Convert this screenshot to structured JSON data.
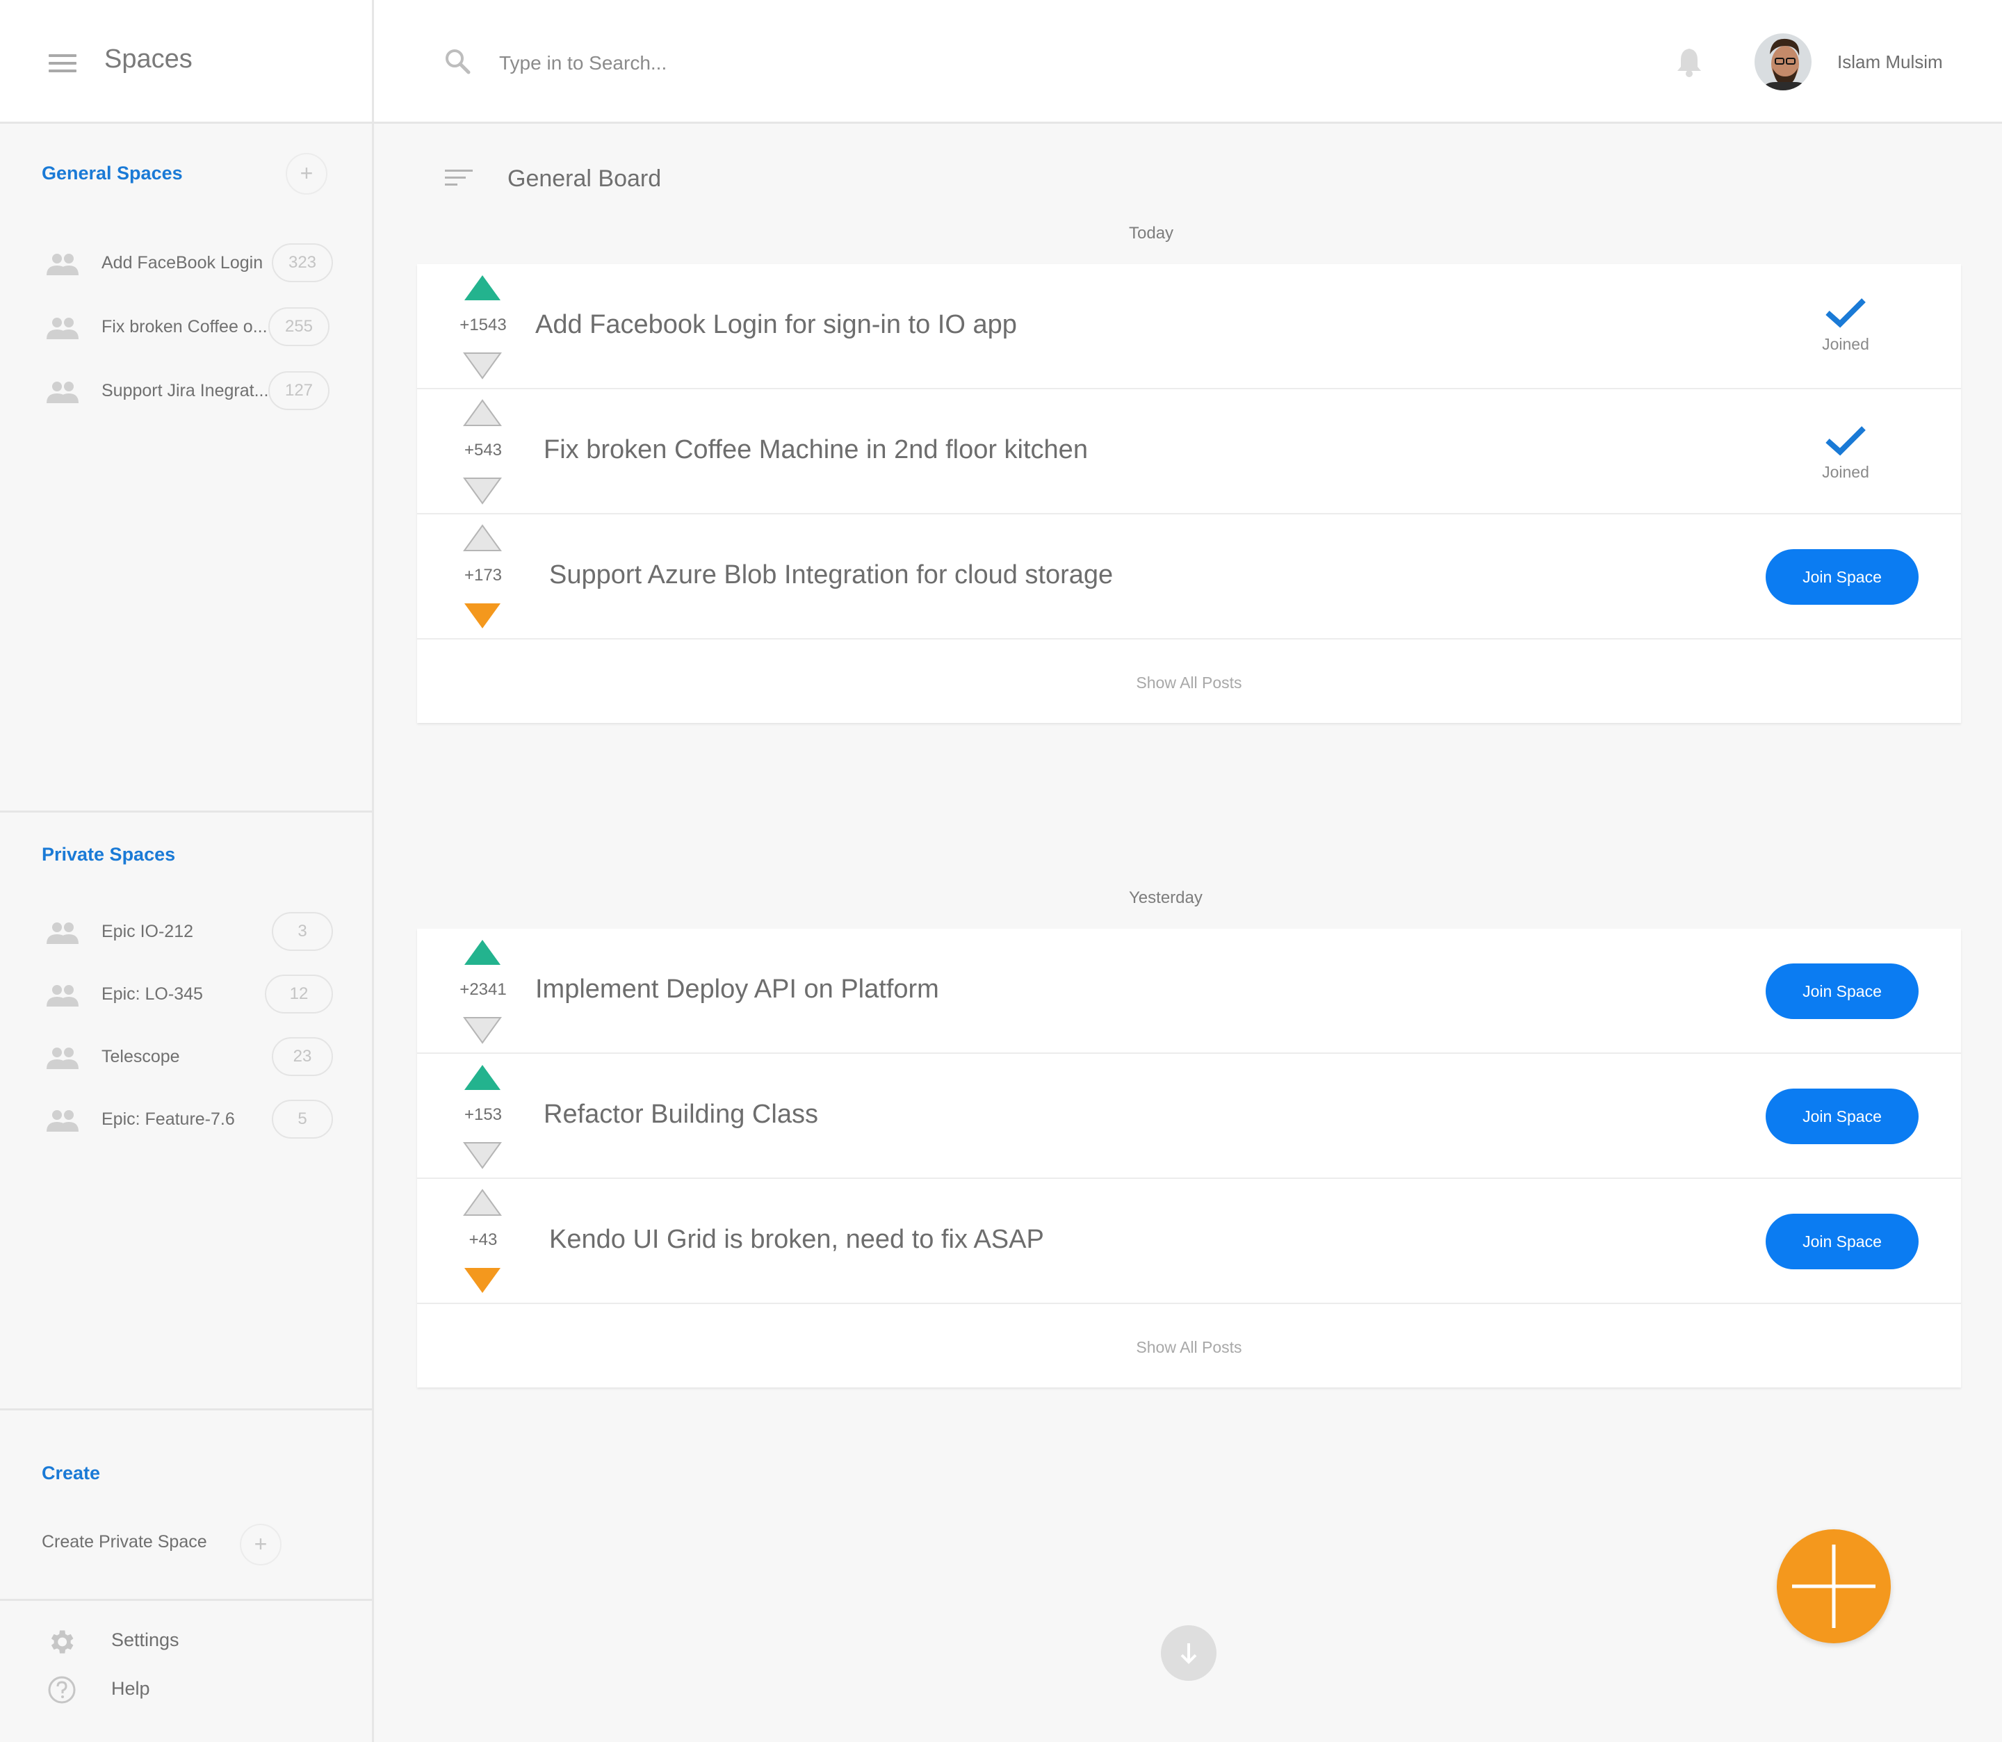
{
  "sidebar": {
    "title": "Spaces",
    "general": {
      "title": "General Spaces",
      "items": [
        {
          "label": "Add FaceBook Login",
          "count": "323"
        },
        {
          "label": "Fix broken Coffee o...",
          "count": "255"
        },
        {
          "label": "Support Jira Inegrat...",
          "count": "127"
        }
      ]
    },
    "private": {
      "title": "Private Spaces",
      "items": [
        {
          "label": "Epic IO-212",
          "count": "3"
        },
        {
          "label": "Epic: LO-345",
          "count": "12"
        },
        {
          "label": "Telescope",
          "count": "23"
        },
        {
          "label": "Epic: Feature-7.6",
          "count": "5"
        }
      ]
    },
    "create": {
      "title": "Create",
      "item": "Create Private Space"
    },
    "settings": "Settings",
    "help": "Help"
  },
  "header": {
    "search_placeholder": "Type in to Search...",
    "user_name": "Islam Mulsim"
  },
  "board": {
    "title": "General Board",
    "groups": [
      {
        "label": "Today",
        "show_all": "Show All Posts",
        "posts": [
          {
            "votes": "+1543",
            "title": "Add Facebook Login for sign-in to IO app",
            "vote_state": "up",
            "status": "Joined"
          },
          {
            "votes": "+543",
            "title": "Fix broken Coffee Machine in 2nd floor kitchen",
            "vote_state": "none",
            "status": "Joined"
          },
          {
            "votes": "+173",
            "title": "Support Azure Blob Integration for cloud storage",
            "vote_state": "down",
            "action": "Join Space"
          }
        ]
      },
      {
        "label": "Yesterday",
        "show_all": "Show All Posts",
        "posts": [
          {
            "votes": "+2341",
            "title": "Implement Deploy API on Platform",
            "vote_state": "up",
            "action": "Join Space"
          },
          {
            "votes": "+153",
            "title": "Refactor Building Class",
            "vote_state": "up",
            "action": "Join Space"
          },
          {
            "votes": "+43",
            "title": "Kendo UI Grid is broken, need to fix ASAP",
            "vote_state": "down",
            "action": "Join Space"
          }
        ]
      }
    ]
  },
  "colors": {
    "accent_blue": "#0b7cf2",
    "section_blue": "#1a7ad6",
    "upvote_green": "#23b38e",
    "downvote_orange": "#f4981d",
    "fab_orange": "#f4981d"
  },
  "icons": [
    "menu-icon",
    "search-icon",
    "bell-icon",
    "people-icon",
    "plus-icon",
    "sort-icon",
    "check-icon",
    "gear-icon",
    "help-icon",
    "arrow-down-icon"
  ]
}
